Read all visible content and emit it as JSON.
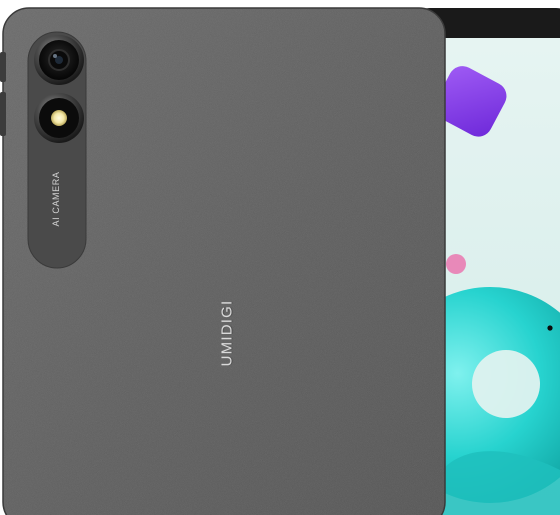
{
  "camera_module": {
    "label": "AI CAMERA"
  },
  "brand": {
    "logo_text": "UMIDIGI"
  },
  "colors": {
    "back_panel": "#5f5f5f",
    "front_bezel": "#1b1b1b",
    "screen_bg": "#dff2ef",
    "accent_purple": "#8a42e8",
    "accent_cyan": "#25d6d2",
    "accent_pink": "#e889b9"
  }
}
